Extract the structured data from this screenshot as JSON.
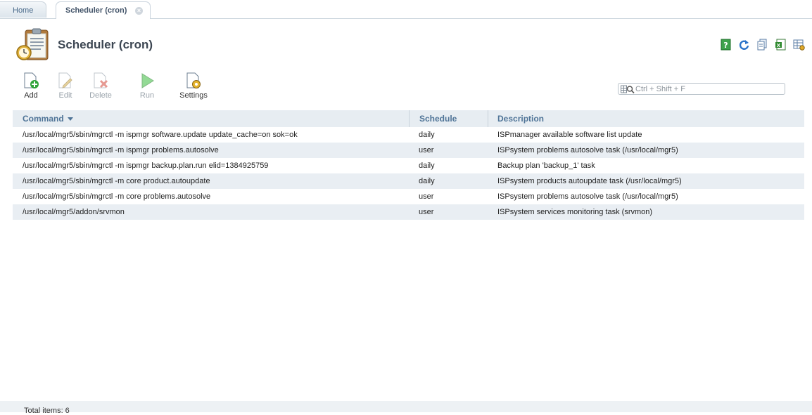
{
  "tabs": [
    {
      "label": "Home"
    },
    {
      "label": "Scheduler (cron)",
      "close": "×"
    }
  ],
  "page": {
    "title": "Scheduler (cron)"
  },
  "toolbar": {
    "add": "Add",
    "edit": "Edit",
    "delete": "Delete",
    "run": "Run",
    "settings": "Settings"
  },
  "search": {
    "placeholder": "Ctrl + Shift + F"
  },
  "table": {
    "columns": [
      "Command",
      "Schedule",
      "Description"
    ],
    "rows": [
      {
        "command": "/usr/local/mgr5/sbin/mgrctl -m ispmgr software.update update_cache=on sok=ok",
        "schedule": "daily",
        "description": "ISPmanager available software list update"
      },
      {
        "command": "/usr/local/mgr5/sbin/mgrctl -m ispmgr problems.autosolve",
        "schedule": "user",
        "description": "ISPsystem problems autosolve task (/usr/local/mgr5)"
      },
      {
        "command": "/usr/local/mgr5/sbin/mgrctl -m ispmgr backup.plan.run elid=1384925759",
        "schedule": "daily",
        "description": "Backup plan 'backup_1' task"
      },
      {
        "command": "/usr/local/mgr5/sbin/mgrctl -m core product.autoupdate",
        "schedule": "daily",
        "description": "ISPsystem products autoupdate task (/usr/local/mgr5)"
      },
      {
        "command": "/usr/local/mgr5/sbin/mgrctl -m core problems.autosolve",
        "schedule": "user",
        "description": "ISPsystem problems autosolve task (/usr/local/mgr5)"
      },
      {
        "command": "/usr/local/mgr5/addon/srvmon",
        "schedule": "user",
        "description": "ISPsystem services monitoring task (srvmon)"
      }
    ]
  },
  "footer": {
    "total": "Total items: 6"
  },
  "colors": {
    "accent": "#4f7497",
    "header_bg": "#e7edf2",
    "row_alt": "#e9eef3"
  },
  "icons": {
    "page": "scheduler-clipboard-clock-icon",
    "tools": [
      "help-icon",
      "refresh-icon",
      "copy-icon",
      "excel-export-icon",
      "table-settings-icon"
    ],
    "toolbar": [
      "add-icon",
      "edit-icon",
      "delete-icon",
      "run-icon",
      "settings-icon"
    ]
  }
}
